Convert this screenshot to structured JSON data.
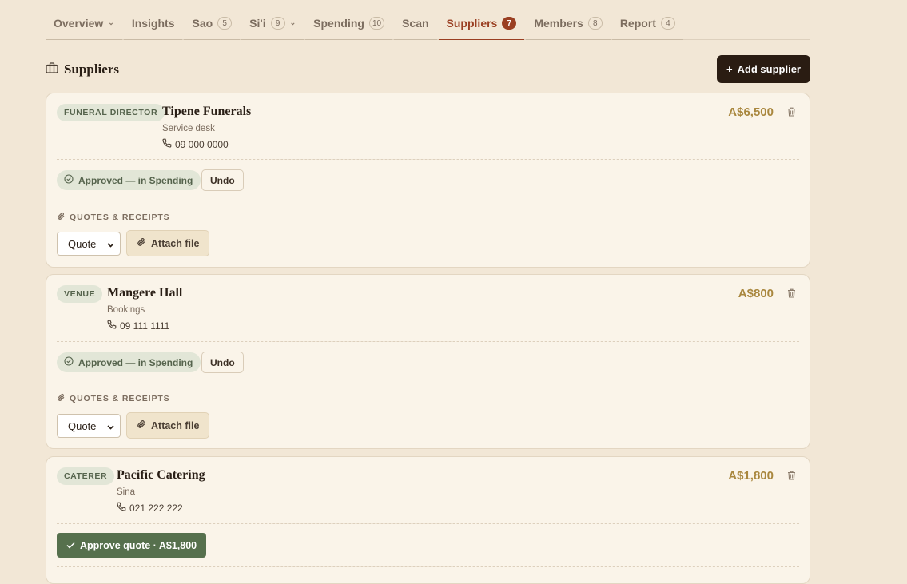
{
  "tabs": [
    {
      "label": "Overview",
      "count": null,
      "dropdown": true
    },
    {
      "label": "Insights",
      "count": null,
      "dropdown": false
    },
    {
      "label": "Sao",
      "count": "5",
      "dropdown": false
    },
    {
      "label": "Si'i",
      "count": "9",
      "dropdown": true
    },
    {
      "label": "Spending",
      "count": "10",
      "dropdown": false
    },
    {
      "label": "Scan",
      "count": null,
      "dropdown": false
    },
    {
      "label": "Suppliers",
      "count": "7",
      "dropdown": false,
      "active": true
    },
    {
      "label": "Members",
      "count": "8",
      "dropdown": false
    },
    {
      "label": "Report",
      "count": "4",
      "dropdown": false
    }
  ],
  "header": {
    "title": "Suppliers",
    "add_label": "Add supplier",
    "add_icon": "+"
  },
  "suppliers": [
    {
      "category": "FUNERAL DIRECTOR",
      "name": "Tipene Funerals",
      "contact": "Service desk",
      "phone": "09 000 0000",
      "amount": "A$6,500",
      "status": "Approved — in Spending",
      "undo_label": "Undo",
      "quotes_label": "QUOTES & RECEIPTS",
      "doc_type": "Quote",
      "attach_label": "Attach file"
    },
    {
      "category": "VENUE",
      "name": "Mangere Hall",
      "contact": "Bookings",
      "phone": "09 111 1111",
      "amount": "A$800",
      "status": "Approved — in Spending",
      "undo_label": "Undo",
      "quotes_label": "QUOTES & RECEIPTS",
      "doc_type": "Quote",
      "attach_label": "Attach file"
    },
    {
      "category": "CATERER",
      "name": "Pacific Catering",
      "contact": "Sina",
      "phone": "021 222 222",
      "amount": "A$1,800",
      "approve_label": "Approve quote · A$1,800"
    }
  ],
  "colors": {
    "accent": "#9a3f22",
    "approve": "#56704d",
    "amount": "#a9873e",
    "dark": "#2a1c12"
  }
}
